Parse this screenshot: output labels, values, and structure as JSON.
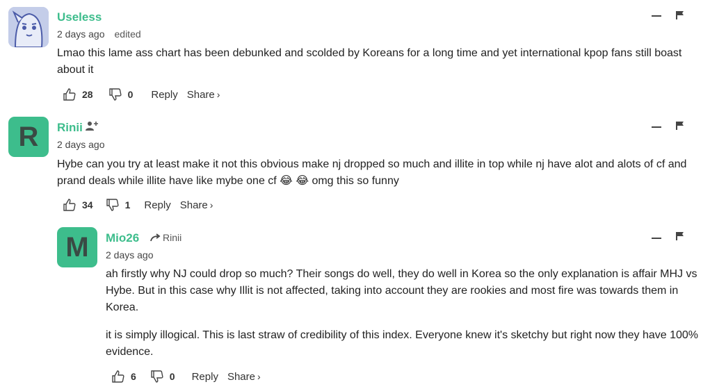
{
  "comments": [
    {
      "username": "Useless",
      "time": "2 days ago",
      "edited": "edited",
      "paragraphs": [
        "Lmao this lame ass chart has been debunked and scolded by Koreans for a long time and yet international kpop fans still boast about it"
      ],
      "likes": "28",
      "dislikes": "0",
      "reply_label": "Reply",
      "share_label": "Share",
      "share_arrow": "›",
      "avatar_icon": "cartoon-face-avatar"
    },
    {
      "username": "Rinii",
      "avatar_letter": "R",
      "time": "2 days ago",
      "paragraphs": [
        "Hybe can you try at least make it not this obvious make nj dropped so much and illite in top while nj have alot and alots of cf and prand deals while illite have like mybe one cf 😂 😂 omg this so funny"
      ],
      "likes": "34",
      "dislikes": "1",
      "reply_label": "Reply",
      "share_label": "Share",
      "share_arrow": "›"
    },
    {
      "username": "Mio26",
      "avatar_letter": "M",
      "reply_to": "Rinii",
      "time": "2 days ago",
      "paragraphs": [
        "ah firstly why NJ could drop so much? Their songs do well, they do well in Korea so the only explanation is affair MHJ vs Hybe. But in this case why Illit is not affected, taking into account they are rookies and most fire was towards them in Korea.",
        "it is simply illogical. This is last straw of credibility of this index. Everyone knew it's sketchy but right now they have 100% evidence."
      ],
      "likes": "6",
      "dislikes": "0",
      "reply_label": "Reply",
      "share_label": "Share",
      "share_arrow": "›"
    }
  ],
  "colors": {
    "username": "#3dbd8c",
    "avatar_bg": "#3dbd8c",
    "text": "#222222"
  }
}
